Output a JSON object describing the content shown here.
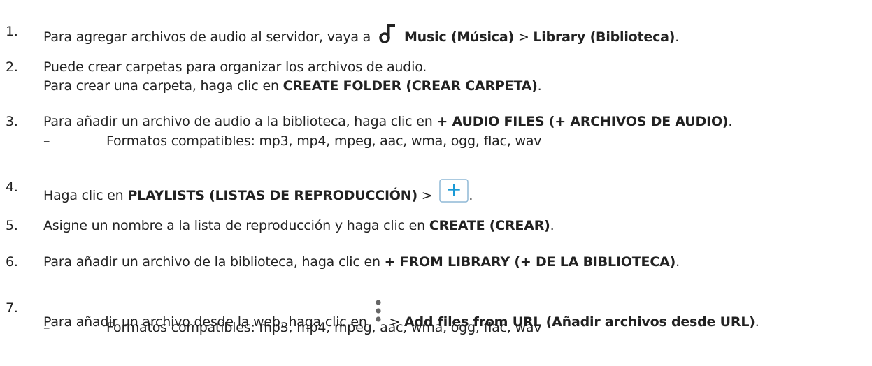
{
  "steps": [
    {
      "num": "1.",
      "pre": "Para agregar archivos de audio al servidor, vaya a ",
      "icon": "music-note-icon",
      "b1": "Music (Música)",
      "sep": " > ",
      "b2": "Library (Biblioteca)",
      "post": "."
    },
    {
      "num": "2.",
      "line1": "Puede crear carpetas para organizar los archivos de audio.",
      "pre": "Para crear una carpeta, haga clic en ",
      "b1": "CREATE FOLDER (CREAR CARPETA)",
      "post": "."
    },
    {
      "num": "3.",
      "pre": "Para añadir un archivo de audio a la biblioteca, haga clic en ",
      "b1": "+ AUDIO FILES (+ ARCHIVOS DE AUDIO)",
      "post": ".",
      "sub_dash": "–",
      "sub": "Formatos compatibles: mp3, mp4, mpeg, aac, wma, ogg, flac, wav"
    },
    {
      "num": "4.",
      "pre": "Haga clic en ",
      "b1": "PLAYLISTS (LISTAS DE REPRODUCCIÓN)",
      "sep": " > ",
      "icon": "add-button-icon",
      "post": "."
    },
    {
      "num": "5.",
      "pre": "Asigne un nombre a la lista de reproducción y haga clic en ",
      "b1": "CREATE (CREAR)",
      "post": "."
    },
    {
      "num": "6.",
      "pre": "Para añadir un archivo de la biblioteca, haga clic en ",
      "b1": "+ FROM LIBRARY (+ DE LA BIBLIOTECA)",
      "post": "."
    },
    {
      "num": "7.",
      "pre": "Para añadir un archivo desde la web, haga clic en ",
      "icon": "more-options-icon",
      "sep": " > ",
      "b1": "Add files from URL (Añadir archivos desde URL)",
      "post": ".",
      "sub_dash": "–",
      "sub": "Formatos compatibles: mp3, mp4, mpeg, aac, wma, ogg, flac, wav"
    }
  ],
  "colors": {
    "text": "#222222",
    "icon_blue": "#1a9ad6",
    "icon_border": "#8fb8d6"
  }
}
